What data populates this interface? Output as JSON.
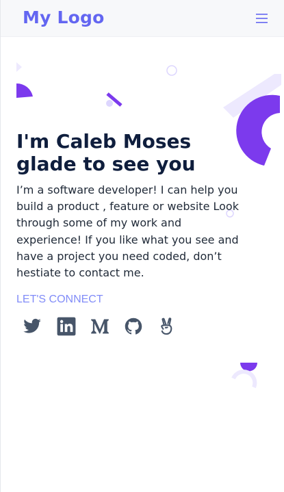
{
  "header": {
    "logo": "My Logo",
    "menu_icon": "hamburger-menu-icon"
  },
  "hero": {
    "title_line1": "I'm Caleb Moses",
    "title_line2": "glade to see you",
    "description": "I’m a software developer! I can help you build a product , feature or website Look through some of my work and experience! If you like what you see and have a project you need coded, don’t hestiate to contact me.",
    "connect_label": "LET'S CONNECT"
  },
  "socials": [
    {
      "name": "twitter",
      "icon": "twitter-icon"
    },
    {
      "name": "linkedin",
      "icon": "linkedin-icon"
    },
    {
      "name": "medium",
      "icon": "medium-icon"
    },
    {
      "name": "github",
      "icon": "github-icon"
    },
    {
      "name": "angellist",
      "icon": "angellist-icon"
    }
  ],
  "colors": {
    "brand": "#6366f1",
    "accent_purple": "#7c3aed",
    "light_purple": "#ede9fe",
    "title": "#0f1e3d",
    "icon": "#475569"
  }
}
